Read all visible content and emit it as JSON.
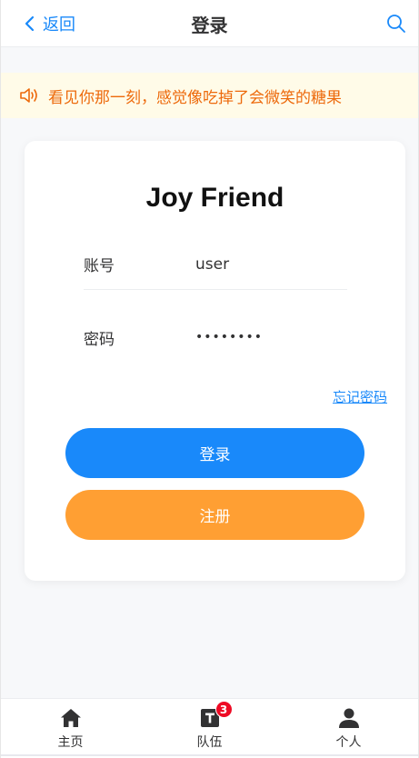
{
  "navbar": {
    "back_label": "返回",
    "title": "登录",
    "search_icon": "search-icon"
  },
  "notice": {
    "icon": "volume-icon",
    "text": "看见你那一刻，感觉像吃掉了会微笑的糖果"
  },
  "login_card": {
    "title": "Joy Friend",
    "account_label": "账号",
    "account_value": "user",
    "password_label": "密码",
    "password_value": "••••••••",
    "forgot_label": "忘记密码",
    "login_button": "登录",
    "register_button": "注册"
  },
  "tabbar": {
    "items": [
      {
        "label": "主页",
        "icon": "home-icon"
      },
      {
        "label": "队伍",
        "icon": "team-icon",
        "badge": "3"
      },
      {
        "label": "个人",
        "icon": "user-icon"
      }
    ]
  },
  "colors": {
    "primary": "#1989fa",
    "warning": "#ff9f33",
    "notice_text": "#ed6a0c",
    "notice_bg": "#fffbe8",
    "badge": "#ee0a24"
  }
}
